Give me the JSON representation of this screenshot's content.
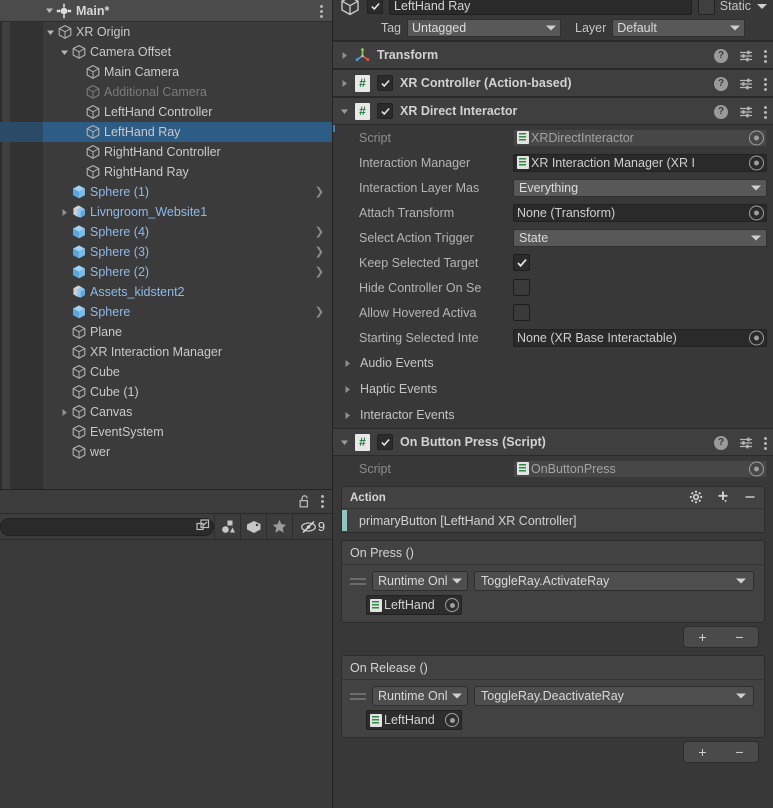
{
  "hierarchy": {
    "scene_name": "Main*",
    "kebab_icon": "kebab-menu-icon",
    "items": [
      {
        "label": "XR Origin",
        "indent": 1,
        "twisty": "down",
        "icon": "gameobject-cube-icon",
        "style": "normal",
        "chevron": false
      },
      {
        "label": "Camera Offset",
        "indent": 2,
        "twisty": "down",
        "icon": "gameobject-cube-icon",
        "style": "normal",
        "chevron": false
      },
      {
        "label": "Main Camera",
        "indent": 3,
        "twisty": "none",
        "icon": "gameobject-cube-icon",
        "style": "normal",
        "chevron": false
      },
      {
        "label": "Additional Camera",
        "indent": 3,
        "twisty": "none",
        "icon": "gameobject-cube-icon",
        "style": "disabled",
        "chevron": false
      },
      {
        "label": "LeftHand Controller",
        "indent": 3,
        "twisty": "none",
        "icon": "gameobject-cube-icon",
        "style": "normal",
        "chevron": false
      },
      {
        "label": "LeftHand Ray",
        "indent": 3,
        "twisty": "none",
        "icon": "gameobject-cube-icon",
        "style": "normal",
        "chevron": false,
        "selected": true
      },
      {
        "label": "RightHand Controller",
        "indent": 3,
        "twisty": "none",
        "icon": "gameobject-cube-icon",
        "style": "normal",
        "chevron": false
      },
      {
        "label": "RightHand Ray",
        "indent": 3,
        "twisty": "none",
        "icon": "gameobject-cube-icon",
        "style": "normal",
        "chevron": false
      },
      {
        "label": "Sphere (1)",
        "indent": 2,
        "twisty": "none",
        "icon": "prefab-cube-icon",
        "style": "prefab",
        "chevron": true
      },
      {
        "label": "Livngroom_Website1",
        "indent": 2,
        "twisty": "right",
        "icon": "prefab-model-icon",
        "style": "prefab",
        "chevron": false
      },
      {
        "label": "Sphere (4)",
        "indent": 2,
        "twisty": "none",
        "icon": "prefab-cube-icon",
        "style": "prefab",
        "chevron": true
      },
      {
        "label": "Sphere (3)",
        "indent": 2,
        "twisty": "none",
        "icon": "prefab-cube-icon",
        "style": "prefab",
        "chevron": true
      },
      {
        "label": "Sphere (2)",
        "indent": 2,
        "twisty": "none",
        "icon": "prefab-cube-icon",
        "style": "prefab",
        "chevron": true
      },
      {
        "label": "Assets_kidstent2",
        "indent": 2,
        "twisty": "none",
        "icon": "prefab-model-icon",
        "style": "prefab",
        "chevron": false
      },
      {
        "label": "Sphere",
        "indent": 2,
        "twisty": "none",
        "icon": "prefab-cube-icon",
        "style": "prefab",
        "chevron": true
      },
      {
        "label": "Plane",
        "indent": 2,
        "twisty": "none",
        "icon": "gameobject-cube-icon",
        "style": "normal",
        "chevron": false
      },
      {
        "label": "XR Interaction Manager",
        "indent": 2,
        "twisty": "none",
        "icon": "gameobject-cube-icon",
        "style": "normal",
        "chevron": false
      },
      {
        "label": "Cube",
        "indent": 2,
        "twisty": "none",
        "icon": "gameobject-cube-icon",
        "style": "normal",
        "chevron": false
      },
      {
        "label": "Cube (1)",
        "indent": 2,
        "twisty": "none",
        "icon": "gameobject-cube-icon",
        "style": "normal",
        "chevron": false
      },
      {
        "label": "Canvas",
        "indent": 2,
        "twisty": "right",
        "icon": "gameobject-cube-icon",
        "style": "normal",
        "chevron": false
      },
      {
        "label": "EventSystem",
        "indent": 2,
        "twisty": "none",
        "icon": "gameobject-cube-icon",
        "style": "normal",
        "chevron": false
      },
      {
        "label": "wer",
        "indent": 2,
        "twisty": "none",
        "icon": "gameobject-cube-icon",
        "style": "normal",
        "chevron": false
      }
    ]
  },
  "project_panel": {
    "lock_icon": "lock-open-icon",
    "kebab_icon": "kebab-menu-icon",
    "search_value": "",
    "search_placeholder": "",
    "expand_icon": "expand-search-icon",
    "filter_type_icon": "filter-by-type-icon",
    "filter_label_icon": "filter-by-label-icon",
    "favorites_icon": "star-favorites-icon",
    "hidden_icon": "eye-off-icon",
    "hidden_count": "9"
  },
  "inspector": {
    "gameobject_icon": "gameobject-cube-icon",
    "enabled_checkbox": true,
    "name_value": "LeftHand Ray",
    "name_placeholder": "Name",
    "static_label": "Static",
    "static_checked": false,
    "tag_label": "Tag",
    "tag_value": "Untagged",
    "layer_label": "Layer",
    "layer_value": "Default",
    "components": [
      {
        "title": "Transform",
        "icon": "transform-axis-icon",
        "expanded": false,
        "has_enable_checkbox": false,
        "help_icon": "help-icon",
        "preset_icon": "preset-icon",
        "kebab_icon": "kebab-menu-icon"
      },
      {
        "title": "XR Controller (Action-based)",
        "icon": "cs-script-icon",
        "expanded": false,
        "has_enable_checkbox": true,
        "enabled": true,
        "help_icon": "help-icon",
        "preset_icon": "preset-icon",
        "kebab_icon": "kebab-menu-icon"
      },
      {
        "title": "XR Direct Interactor",
        "icon": "cs-script-icon",
        "expanded": true,
        "has_enable_checkbox": true,
        "enabled": true,
        "help_icon": "help-icon",
        "preset_icon": "preset-icon",
        "kebab_icon": "kebab-menu-icon"
      }
    ],
    "direct_interactor": {
      "properties": [
        {
          "label": "Script",
          "kind": "object-readonly",
          "value": "XRDirectInteractor",
          "icon": "cs-script-icon"
        },
        {
          "label": "Interaction Manager",
          "kind": "object",
          "value": "XR Interaction Manager (XR I",
          "icon": "cs-script-icon"
        },
        {
          "label": "Interaction Layer Mas",
          "kind": "dropdown",
          "value": "Everything"
        },
        {
          "label": "Attach Transform",
          "kind": "object",
          "value": "None (Transform)"
        },
        {
          "label": "Select Action Trigger",
          "kind": "dropdown",
          "value": "State"
        },
        {
          "label": "Keep Selected Target",
          "kind": "checkbox",
          "checked": true
        },
        {
          "label": "Hide Controller On Se",
          "kind": "checkbox",
          "checked": false
        },
        {
          "label": "Allow Hovered Activa",
          "kind": "checkbox",
          "checked": false
        },
        {
          "label": "Starting Selected Inte",
          "kind": "object",
          "value": "None (XR Base Interactable)"
        }
      ],
      "foldouts": [
        {
          "label": "Audio Events",
          "expanded": false
        },
        {
          "label": "Haptic Events",
          "expanded": false
        },
        {
          "label": "Interactor Events",
          "expanded": false
        }
      ]
    },
    "on_button_press": {
      "title": "On Button Press (Script)",
      "icon": "cs-script-icon",
      "expanded": true,
      "enabled": true,
      "help_icon": "help-icon",
      "preset_icon": "preset-icon",
      "kebab_icon": "kebab-menu-icon",
      "script_label": "Script",
      "script_value": "OnButtonPress",
      "action": {
        "header": "Action",
        "gear_icon": "gear-icon",
        "add_icon": "plus-icon",
        "remove_icon": "minus-icon",
        "binding": "primaryButton [LeftHand XR Controller]",
        "accent_color": "#8fc4c0"
      },
      "events": [
        {
          "header": "On Press ()",
          "entry": {
            "drag_handle_icon": "drag-handle-icon",
            "scope": "Runtime Onl",
            "method": "ToggleRay.ActivateRay",
            "target": "LeftHand",
            "target_icon": "cs-script-icon"
          },
          "add_label": "+",
          "remove_label": "−"
        },
        {
          "header": "On Release ()",
          "entry": {
            "drag_handle_icon": "drag-handle-icon",
            "scope": "Runtime Onl",
            "method": "ToggleRay.DeactivateRay",
            "target": "LeftHand",
            "target_icon": "cs-script-icon"
          },
          "add_label": "+",
          "remove_label": "−"
        }
      ]
    }
  },
  "colors": {
    "background": "#383838",
    "panel": "#3b3b3b",
    "header": "#3f3f3f",
    "selection": "#2d5c86",
    "accent_blue": "#3b7fc4",
    "prefab_text": "#8fb9e8",
    "action_accent": "#8fc4c0"
  }
}
